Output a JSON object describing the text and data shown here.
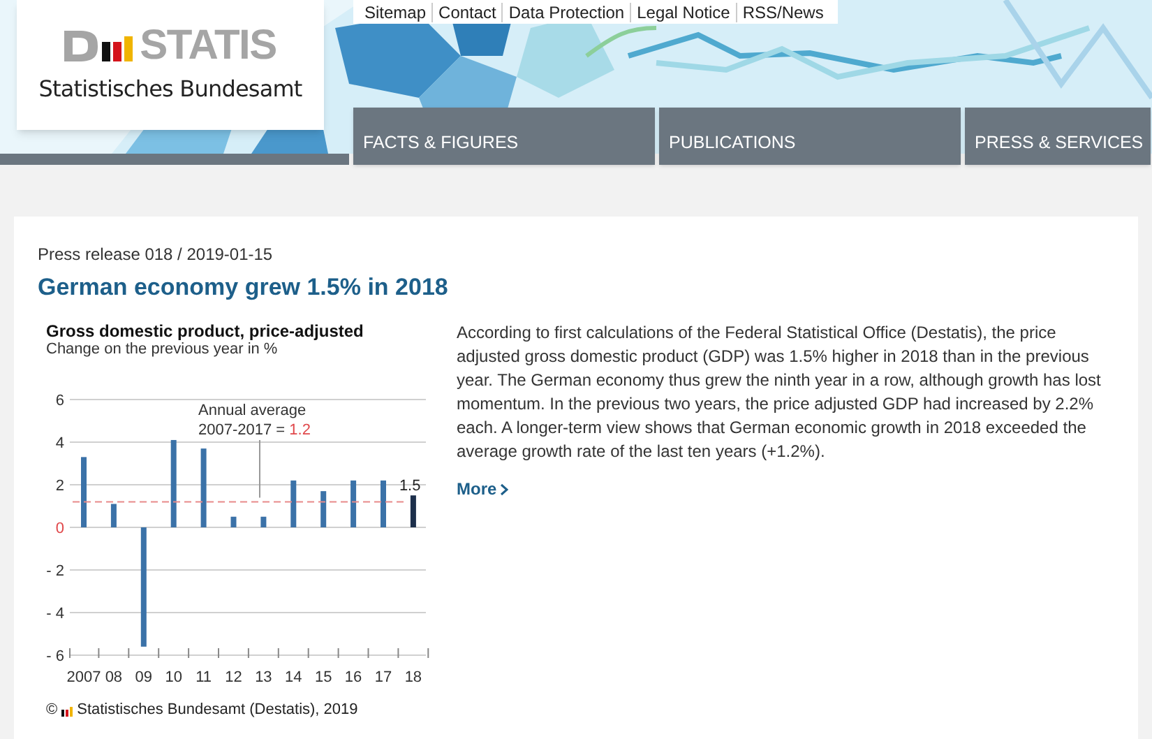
{
  "logo": {
    "wordmark": "STATIS",
    "subtitle": "Statistisches Bundesamt"
  },
  "top_links": [
    "Sitemap",
    "Contact",
    "Data Protection",
    "Legal Notice",
    "RSS/News"
  ],
  "nav_tabs": [
    {
      "label": "FACTS & FIGURES"
    },
    {
      "label": "PUBLICATIONS"
    },
    {
      "label": "PRESS & SERVICES"
    }
  ],
  "article": {
    "meta": "Press release 018 / 2019-01-15",
    "title": "German economy grew 1.5% in 2018",
    "body": "According to first calculations of the Federal Statistical Office (Destatis), the price adjusted gross domestic product (GDP) was 1.5% higher in 2018 than in the previous year. The German economy thus grew the ninth year in a row, although growth has lost momentum. In the previous two years, the price adjusted GDP had increased by 2.2% each. A longer-term view shows that German economic growth in 2018 exceeded the average growth rate of the last ten years (+1.2%).",
    "more_link": "More"
  },
  "figure": {
    "title": "Gross domestic product, price-adjusted",
    "subtitle": "Change on the previous year in %",
    "chart_data": {
      "type": "bar",
      "categories": [
        "2007",
        "08",
        "09",
        "10",
        "11",
        "12",
        "13",
        "14",
        "15",
        "16",
        "17",
        "18"
      ],
      "series": [
        {
          "color": "#3b72a8",
          "values": [
            3.3,
            1.1,
            -5.6,
            4.1,
            3.7,
            0.5,
            0.5,
            2.2,
            1.7,
            2.2,
            2.2,
            null
          ]
        },
        {
          "color": "#1c2f4b",
          "values": [
            null,
            null,
            null,
            null,
            null,
            null,
            null,
            null,
            null,
            null,
            null,
            1.5
          ]
        }
      ],
      "grid": true,
      "stacked": true,
      "ylim": [
        -6,
        6
      ],
      "yticks": [
        6,
        4,
        2,
        {
          "value": 0,
          "label": "0"
        },
        {
          "value": -2,
          "label": "- 2"
        },
        {
          "value": -4,
          "label": "- 4"
        },
        {
          "value": -6,
          "label": "- 6"
        }
      ],
      "ref_lines": [
        {
          "axis": "y",
          "value": 1.2,
          "color": "#e88a8a"
        }
      ],
      "annotations": [
        "Annual average",
        "2007-2017 = ",
        "1.2",
        {
          "text": "1.5",
          "x": "18",
          "y": 1.5
        }
      ]
    },
    "credit": {
      "symbol": "©",
      "text": "Statistisches Bundesamt (Destatis), 2019"
    }
  }
}
